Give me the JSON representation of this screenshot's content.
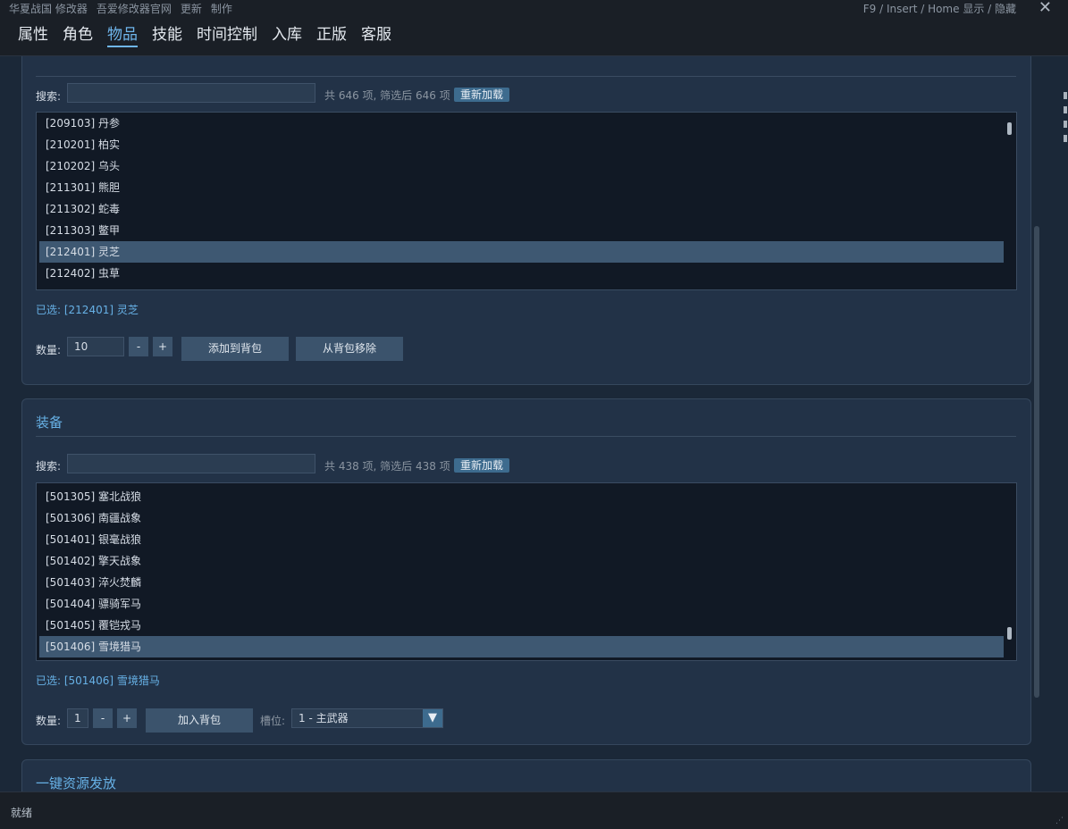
{
  "window": {
    "menu": [
      "华夏战国 修改器",
      "吾爱修改器官网",
      "更新",
      "制作"
    ],
    "hotkey": "F9 / Insert / Home  显示 / 隐藏",
    "close_symbol": "✕"
  },
  "tabs": [
    {
      "label": "属性",
      "active": false
    },
    {
      "label": "角色",
      "active": false
    },
    {
      "label": "物品",
      "active": true
    },
    {
      "label": "技能",
      "active": false
    },
    {
      "label": "时间控制",
      "active": false
    },
    {
      "label": "入库",
      "active": false
    },
    {
      "label": "正版",
      "active": false
    },
    {
      "label": "客服",
      "active": false
    }
  ],
  "items_panel": {
    "search_label": "搜索:",
    "search_value": "",
    "count_text": "共 646 项, 筛选后 646 项",
    "reload_label": "重新加载",
    "list": [
      "[209103] 丹参",
      "[210201] 柏实",
      "[210202] 乌头",
      "[211301] 熊胆",
      "[211302] 蛇毒",
      "[211303] 鳖甲",
      "[212401] 灵芝",
      "[212402] 虫草"
    ],
    "selected_index": 6,
    "selected_text": "已选: [212401] 灵芝",
    "qty_label": "数量:",
    "qty_value": "10",
    "minus": "-",
    "plus": "+",
    "add_label": "添加到背包",
    "remove_label": "从背包移除"
  },
  "equip_panel": {
    "title": "装备",
    "search_label": "搜索:",
    "search_value": "",
    "count_text": "共 438 项, 筛选后 438 项",
    "reload_label": "重新加载",
    "list": [
      "[501305] 塞北战狼",
      "[501306] 南疆战象",
      "[501401] 银毫战狼",
      "[501402] 擎天战象",
      "[501403] 淬火焚麟",
      "[501404] 骠骑军马",
      "[501405] 覆铠戎马",
      "[501406] 雪境猎马"
    ],
    "selected_index": 7,
    "selected_text": "已选: [501406] 雪境猎马",
    "qty_label": "数量:",
    "qty_value": "1",
    "minus": "-",
    "plus": "+",
    "add_label": "加入背包",
    "slot_label": "槽位:",
    "slot_value": "1 - 主武器",
    "dropdown_symbol": "▼"
  },
  "resource_panel": {
    "title": "一键资源发放"
  },
  "status": {
    "text": "就绪"
  }
}
